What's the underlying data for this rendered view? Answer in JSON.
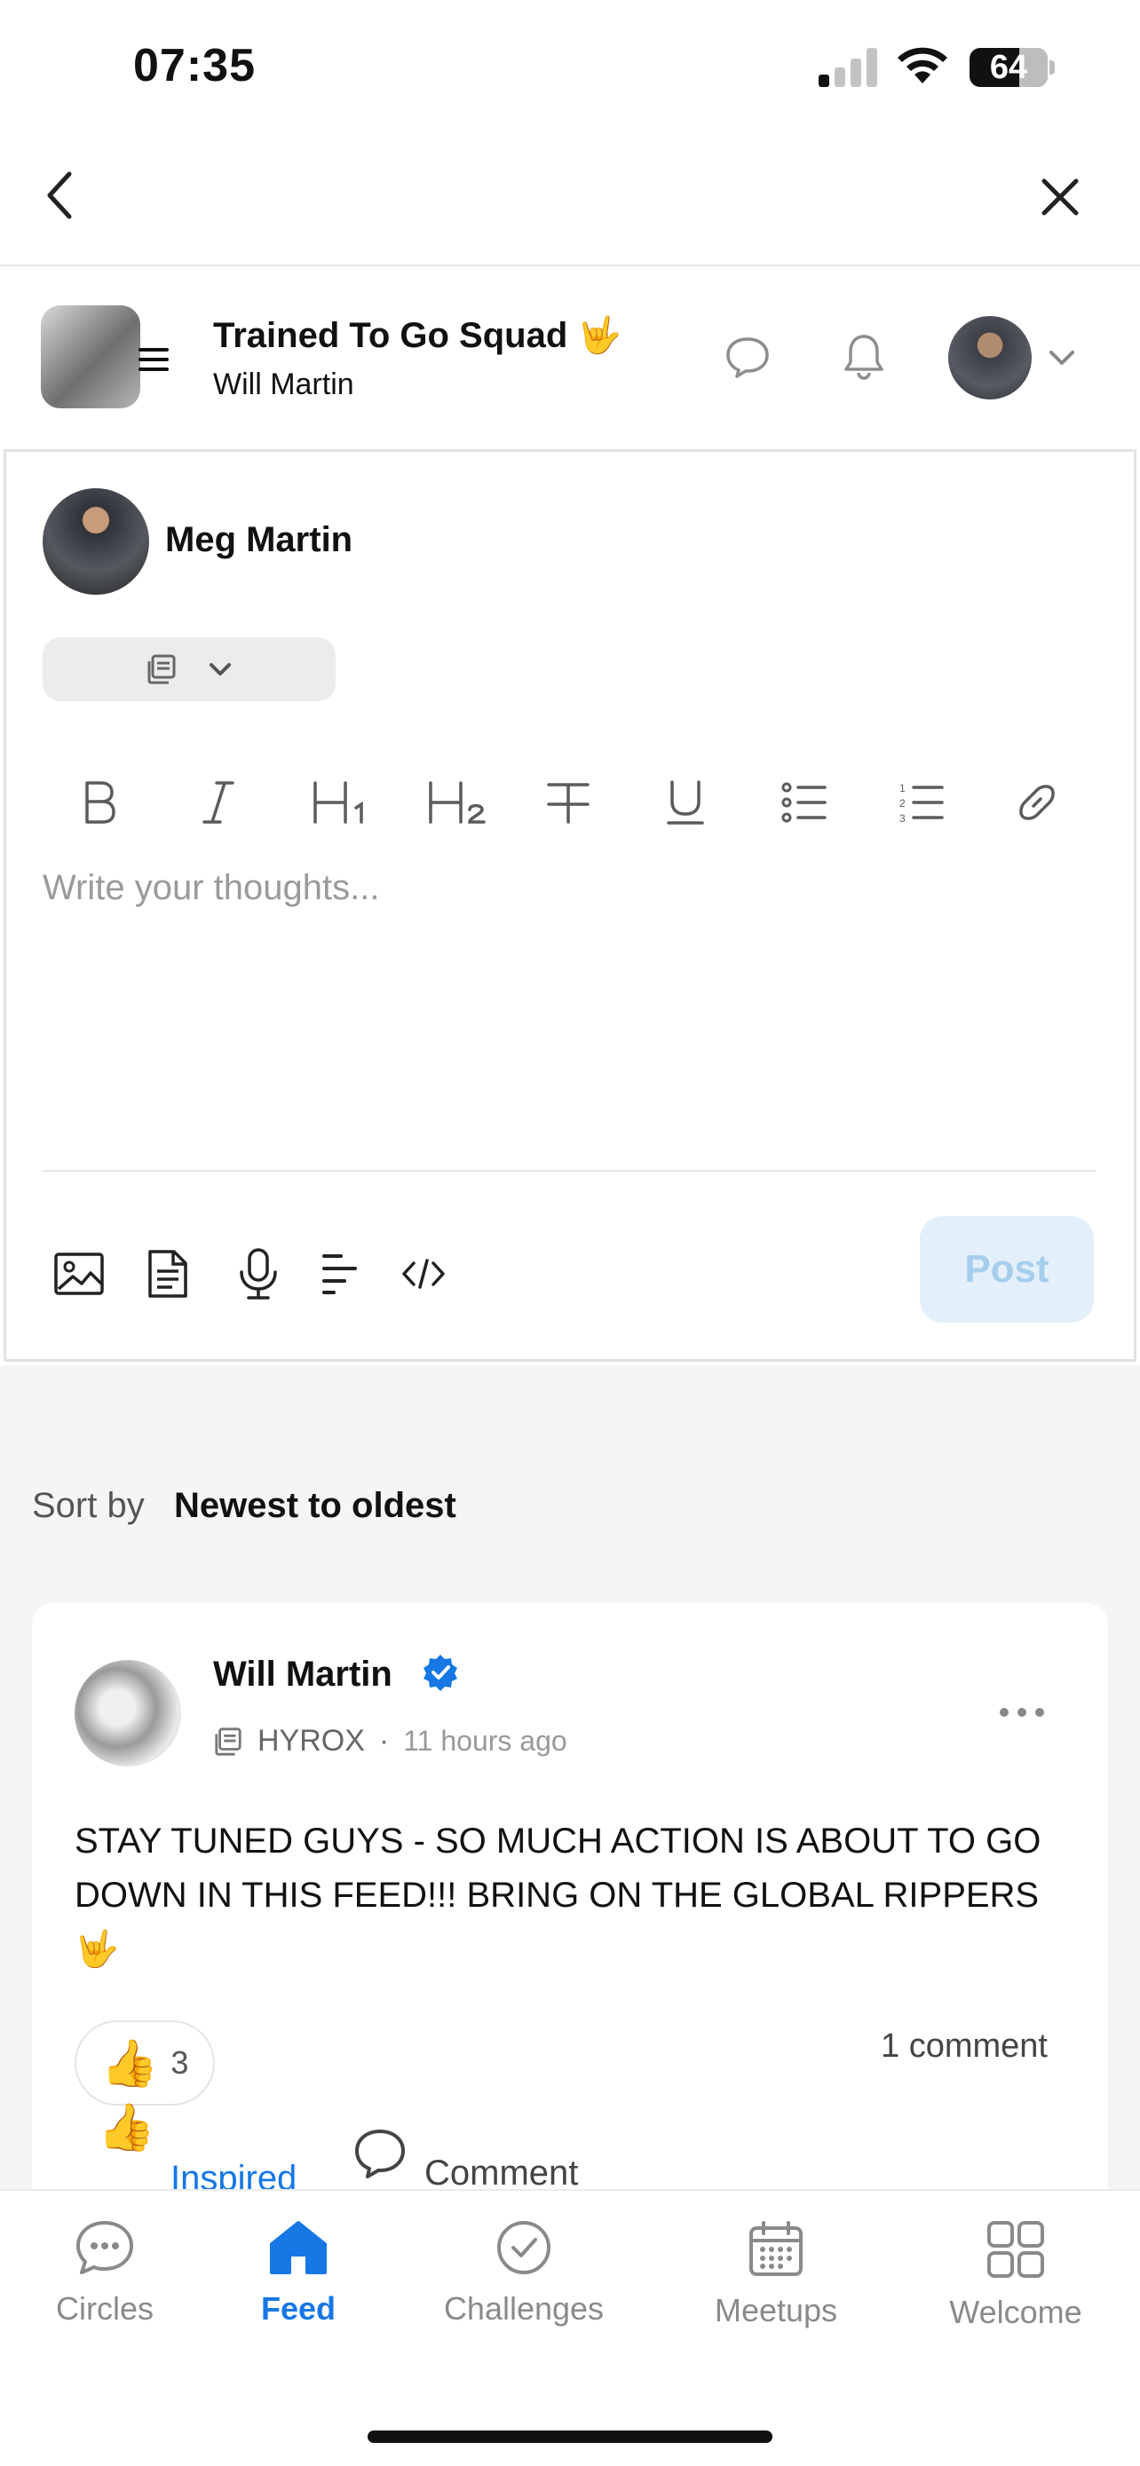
{
  "status_bar": {
    "time": "07:35",
    "battery": "64"
  },
  "community": {
    "title": "Trained To Go Squad 🤟",
    "owner": "Will Martin"
  },
  "composer": {
    "author": "Meg Martin",
    "placeholder": "Write your thoughts...",
    "post_label": "Post",
    "toolbar": [
      "bold-icon",
      "italic-icon",
      "heading1-icon",
      "heading2-icon",
      "strikethrough-icon",
      "underline-icon",
      "bullet-list-icon",
      "numbered-list-icon",
      "link-icon"
    ],
    "attachments": [
      "image-icon",
      "document-icon",
      "microphone-icon",
      "align-icon",
      "code-icon"
    ]
  },
  "feed": {
    "sort_label": "Sort by",
    "sort_value": "Newest to oldest",
    "post": {
      "author": "Will Martin",
      "topic": "HYROX",
      "separator": "·",
      "time": "11 hours ago",
      "body": "STAY TUNED GUYS - SO MUCH ACTION IS ABOUT TO GO DOWN IN THIS FEED!!! BRING ON THE GLOBAL RIPPERS 🤟",
      "reaction_emoji": "👍",
      "reaction_count": "3",
      "comment_count": "1 comment",
      "inspired_label": "Inspired",
      "comment_label": "Comment"
    }
  },
  "tabs": [
    {
      "label": "Circles"
    },
    {
      "label": "Feed",
      "active": true
    },
    {
      "label": "Challenges"
    },
    {
      "label": "Meetups"
    },
    {
      "label": "Welcome"
    }
  ],
  "colors": {
    "accent": "#1677e5",
    "post_button_bg": "#e3f0fb",
    "feed_bg": "#f5f5f5"
  }
}
